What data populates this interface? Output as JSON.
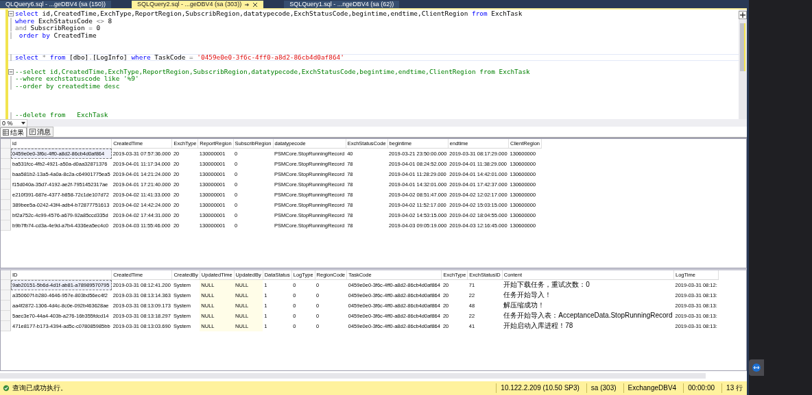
{
  "document_tabs": [
    {
      "label": "QLQuery6.sql - ...geDBV4 (sa (150))",
      "selected": false
    },
    {
      "label": "SQLQuery2.sql - ...geDBV4 (sa (303))",
      "selected": true
    },
    {
      "label": "SQLQuery1.sql - ...ngeDBV4 (sa (62))",
      "selected": false
    }
  ],
  "editor": {
    "lines": [
      {
        "kind": "code",
        "collapsible": true,
        "current": false,
        "tokens": [
          {
            "kind": "keyword",
            "text": "select"
          },
          {
            "kind": "plain",
            "text": " id,CreatedTime,ExchType,ReportRegion,SubscribRegion,datatypecode,ExchStatusCode,begintime,endtime,ClientRegion "
          },
          {
            "kind": "keyword",
            "text": "from"
          },
          {
            "kind": "plain",
            "text": " ExchTask"
          }
        ]
      },
      {
        "kind": "code",
        "collapsible": false,
        "current": false,
        "tokens": [
          {
            "kind": "keyword",
            "text": "where"
          },
          {
            "kind": "plain",
            "text": " ExchStatusCode "
          },
          {
            "kind": "operator",
            "text": "<>"
          },
          {
            "kind": "plain",
            "text": " 8"
          }
        ]
      },
      {
        "kind": "code",
        "collapsible": false,
        "current": false,
        "tokens": [
          {
            "kind": "operator",
            "text": "and"
          },
          {
            "kind": "plain",
            "text": " SubscribRegion "
          },
          {
            "kind": "operator",
            "text": "="
          },
          {
            "kind": "plain",
            "text": " 0"
          }
        ]
      },
      {
        "kind": "code",
        "collapsible": false,
        "current": false,
        "tokens": [
          {
            "kind": "keyword",
            "text": " order by"
          },
          {
            "kind": "plain",
            "text": " CreatedTime"
          }
        ]
      },
      {
        "kind": "blank"
      },
      {
        "kind": "blank"
      },
      {
        "kind": "code",
        "collapsible": false,
        "current": true,
        "tokens": [
          {
            "kind": "keyword",
            "text": "select"
          },
          {
            "kind": "operator",
            "text": " * "
          },
          {
            "kind": "keyword",
            "text": "from"
          },
          {
            "kind": "plain",
            "text": " [dbo]"
          },
          {
            "kind": "operator",
            "text": "."
          },
          {
            "kind": "plain",
            "text": "[LogInfo] "
          },
          {
            "kind": "keyword",
            "text": "where"
          },
          {
            "kind": "plain",
            "text": " TaskCode "
          },
          {
            "kind": "operator",
            "text": "= "
          },
          {
            "kind": "string",
            "text": "'0459e0e0-3f6c-4ff0-a8d2-86cb4d0af864'"
          }
        ]
      },
      {
        "kind": "blank"
      },
      {
        "kind": "code",
        "collapsible": true,
        "current": false,
        "tokens": [
          {
            "kind": "comment",
            "text": "--select id,CreatedTime,ExchType,ReportRegion,SubscribRegion,datatypecode,ExchStatusCode,begintime,endtime,ClientRegion from ExchTask"
          }
        ]
      },
      {
        "kind": "code",
        "collapsible": false,
        "current": false,
        "tokens": [
          {
            "kind": "comment",
            "text": "--where exchstatuscode like '%9'"
          }
        ]
      },
      {
        "kind": "code",
        "collapsible": false,
        "current": false,
        "tokens": [
          {
            "kind": "comment",
            "text": "--order by createdtime desc"
          }
        ]
      },
      {
        "kind": "blank"
      },
      {
        "kind": "blank"
      },
      {
        "kind": "blank"
      },
      {
        "kind": "code",
        "collapsible": false,
        "current": false,
        "tokens": [
          {
            "kind": "comment",
            "text": "--delete from   ExchTask"
          }
        ]
      }
    ]
  },
  "zoom": {
    "value": "0 %"
  },
  "result_tabs": [
    {
      "label": "结果",
      "selected": true
    },
    {
      "label": "消息",
      "selected": false
    }
  ],
  "grids": [
    {
      "columns": [
        {
          "label": "id"
        },
        {
          "label": "CreatedTime"
        },
        {
          "label": "ExchType"
        },
        {
          "label": "ReportRegion"
        },
        {
          "label": "SubscribRegion"
        },
        {
          "label": "datatypecode"
        },
        {
          "label": "ExchStatusCode"
        },
        {
          "label": "begintime"
        },
        {
          "label": "endtime"
        },
        {
          "label": "ClientRegion"
        }
      ],
      "rows": [
        {
          "focused": true,
          "cells": [
            "0459e0e0-3f6c-4ff0-a8d2-86cb4d0af864",
            "2019-03-31 07:57:36.000",
            "20",
            "130000001",
            "0",
            "PSMCore.StopRunningRecord",
            "40",
            "2019-03-21 23:50:00.000",
            "2019-03-31 08:17:29.000",
            "130600000"
          ]
        },
        {
          "focused": false,
          "cells": [
            "ba531fcc-4fb2-4921-a50a-d0aa32871376",
            "2019-04-01 11:17:34.000",
            "20",
            "130000001",
            "0",
            "PSMCore.StopRunningRecord",
            "78",
            "2019-04-01 08:24:52.000",
            "2019-04-01 11:38:29.000",
            "130600000"
          ]
        },
        {
          "focused": false,
          "cells": [
            "baa581b2-13a5-4a0a-8c2a-c64901775ea5",
            "2019-04-01 14:21:24.000",
            "20",
            "130000001",
            "0",
            "PSMCore.StopRunningRecord",
            "78",
            "2019-04-01 11:28:29.000",
            "2019-04-01 14:42:01.000",
            "130600000"
          ]
        },
        {
          "focused": false,
          "cells": [
            "f15d040a-35d7-4192-ae2f-7951452317ae",
            "2019-04-01 17:21:40.000",
            "20",
            "130000001",
            "0",
            "PSMCore.StopRunningRecord",
            "78",
            "2019-04-01 14:32:01.000",
            "2019-04-01 17:42:37.000",
            "130600000"
          ]
        },
        {
          "focused": false,
          "cells": [
            "e210f391-687e-4377-b858-72c1de107d72",
            "2019-04-02 11:41:33.000",
            "20",
            "130000001",
            "0",
            "PSMCore.StopRunningRecord",
            "78",
            "2019-04-02 08:51:47.000",
            "2019-04-02 12:02:17.000",
            "130600000"
          ]
        },
        {
          "focused": false,
          "cells": [
            "389bee5a-0242-43f4-adb4-b72877751613",
            "2019-04-02 14:42:24.000",
            "20",
            "130000001",
            "0",
            "PSMCore.StopRunningRecord",
            "78",
            "2019-04-02 11:52:17.000",
            "2019-04-02 15:03:15.000",
            "130600000"
          ]
        },
        {
          "focused": false,
          "cells": [
            "bf2a752c-4c99-4576-a679-92a85ccd335d",
            "2019-04-02 17:44:31.000",
            "20",
            "130000001",
            "0",
            "PSMCore.StopRunningRecord",
            "78",
            "2019-04-02 14:53:15.000",
            "2019-04-02 18:04:55.000",
            "130600000"
          ]
        },
        {
          "focused": false,
          "cells": [
            "b9b7fb74-cd3a-4e9d-a7b4-4336ea5ec4c0",
            "2019-04-03 11:55:46.000",
            "20",
            "130000001",
            "0",
            "PSMCore.StopRunningRecord",
            "78",
            "2019-04-03 09:05:19.000",
            "2019-04-03 12:16:45.000",
            "130600000"
          ]
        }
      ]
    },
    {
      "columns": [
        {
          "label": "ID",
          "highlighted": false
        },
        {
          "label": "CreatedTime",
          "highlighted": false
        },
        {
          "label": "CreatedBy",
          "highlighted": false
        },
        {
          "label": "UpdatedTime",
          "highlighted": true
        },
        {
          "label": "UpdatedBy",
          "highlighted": true
        },
        {
          "label": "DataStatus",
          "highlighted": false
        },
        {
          "label": "LogType",
          "highlighted": false
        },
        {
          "label": "RegionCode",
          "highlighted": false
        },
        {
          "label": "TaskCode",
          "highlighted": false
        },
        {
          "label": "ExchType",
          "highlighted": false
        },
        {
          "label": "ExchStatusID",
          "highlighted": false
        },
        {
          "label": "Content",
          "highlighted": false
        },
        {
          "label": "LogTime",
          "highlighted": false
        }
      ],
      "rows": [
        {
          "focused": true,
          "cells": [
            "9ab20151-5b6d-4d1f-ab81-a78989570795",
            "2019-03-31 08:12:41.200",
            "System",
            "NULL",
            "NULL",
            "1",
            "0",
            "0",
            "0459e0e0-3f6c-4ff0-a8d2-86cb4d0af864",
            "20",
            "71",
            "开始下载任务，重试次数：0",
            "2019-03-31 08:12:"
          ]
        },
        {
          "focused": false,
          "cells": [
            "a350607f-b280-4646-957e-803bd56ec4f2",
            "2019-03-31 08:13:14.363",
            "System",
            "NULL",
            "NULL",
            "1",
            "0",
            "0",
            "0459e0e0-3f6c-4ff0-a8d2-86cb4d0af864",
            "20",
            "22",
            "任务开始导入！",
            "2019-03-31 08:13:"
          ]
        },
        {
          "focused": false,
          "cells": [
            "aa4f2872-1306-4d4c-8c0e-092b463628ae",
            "2019-03-31 08:13:09.173",
            "System",
            "NULL",
            "NULL",
            "1",
            "0",
            "0",
            "0459e0e0-3f6c-4ff0-a8d2-86cb4d0af864",
            "20",
            "48",
            "解压缩成功！",
            "2019-03-31 08:13:"
          ]
        },
        {
          "focused": false,
          "cells": [
            "5aec3e70-44a4-403b-a276-16b355fdcd14",
            "2019-03-31 08:13:18.297",
            "System",
            "NULL",
            "NULL",
            "1",
            "0",
            "0",
            "0459e0e0-3f6c-4ff0-a8d2-86cb4d0af864",
            "20",
            "22",
            "任务开始导入表：AcceptanceData.StopRunningRecord",
            "2019-03-31 08:13:"
          ]
        },
        {
          "focused": false,
          "cells": [
            "471e8177-b173-4394-ad5c-c078085985bb",
            "2019-03-31 08:13:03.690",
            "System",
            "NULL",
            "NULL",
            "1",
            "0",
            "0",
            "0459e0e0-3f6c-4ff0-a8d2-86cb4d0af864",
            "20",
            "41",
            "开始启动入库进程！78",
            "2019-03-31 08:13:"
          ]
        }
      ]
    }
  ],
  "status_bar": {
    "message": "查询已成功执行。",
    "server": "10.122.2.209 (10.50 SP3)",
    "user": "sa (303)",
    "database": "ExchangeDBV4",
    "elapsed": "00:00:00",
    "rows": "13 行"
  }
}
